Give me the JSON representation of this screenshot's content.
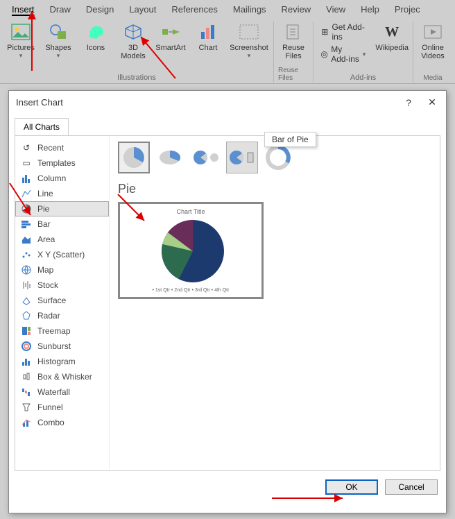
{
  "ribbon": {
    "tabs": [
      "Insert",
      "Draw",
      "Design",
      "Layout",
      "References",
      "Mailings",
      "Review",
      "View",
      "Help",
      "Projec"
    ],
    "active_tab": "Insert",
    "items": {
      "pictures": "Pictures",
      "shapes": "Shapes",
      "icons": "Icons",
      "models": "3D\nModels",
      "smartart": "SmartArt",
      "chart": "Chart",
      "screenshot": "Screenshot",
      "reuse": "Reuse\nFiles",
      "getaddins": "Get Add-ins",
      "myaddins": "My Add-ins",
      "wikipedia": "Wikipedia",
      "onlinevideo": "Online\nVideos"
    },
    "groups": {
      "illustrations": "Illustrations",
      "reusefiles": "Reuse Files",
      "addins": "Add-ins",
      "media": "Media"
    }
  },
  "dialog": {
    "title": "Insert Chart",
    "help": "?",
    "close": "✕",
    "tab": "All Charts",
    "categories": [
      "Recent",
      "Templates",
      "Column",
      "Line",
      "Pie",
      "Bar",
      "Area",
      "X Y (Scatter)",
      "Map",
      "Stock",
      "Surface",
      "Radar",
      "Treemap",
      "Sunburst",
      "Histogram",
      "Box & Whisker",
      "Waterfall",
      "Funnel",
      "Combo"
    ],
    "selected_category": "Pie",
    "subtype_tooltip": "Bar of Pie",
    "chart_label": "Pie",
    "preview": {
      "title": "Chart Title",
      "legend": "• 1st Qtr   • 2nd Qtr   • 3rd Qtr   • 4th Qtr"
    },
    "buttons": {
      "ok": "OK",
      "cancel": "Cancel"
    }
  },
  "chart_data": {
    "type": "pie",
    "title": "Chart Title",
    "categories": [
      "1st Qtr",
      "2nd Qtr",
      "3rd Qtr",
      "4th Qtr"
    ],
    "values": [
      58,
      23,
      10,
      9
    ],
    "colors": [
      "#1d3a6e",
      "#2d6b4f",
      "#a7cf87",
      "#6a2d5a"
    ]
  }
}
